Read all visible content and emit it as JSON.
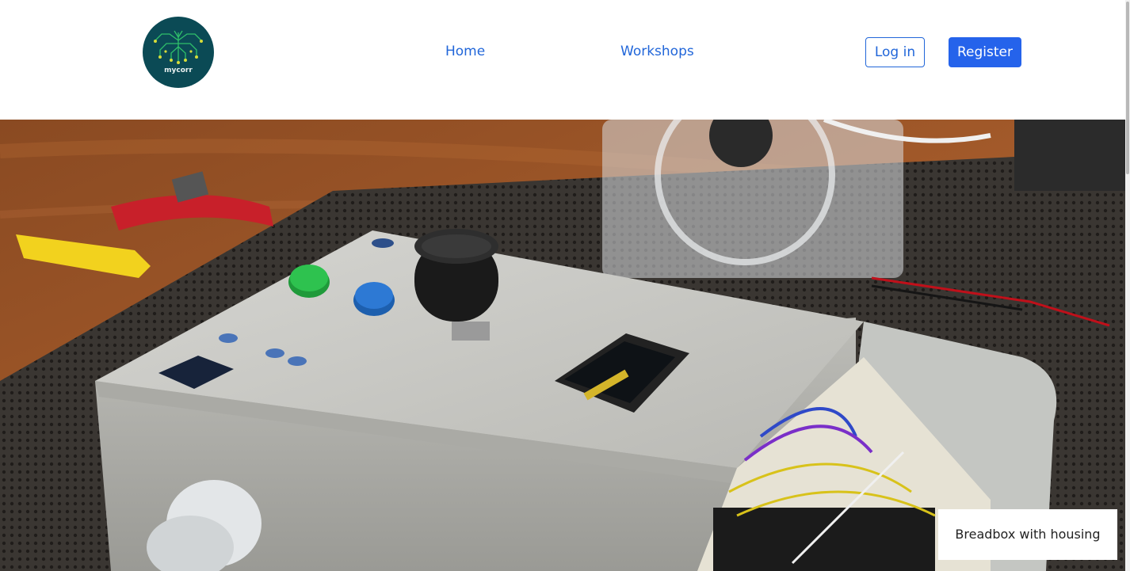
{
  "brand": {
    "logo_text": "mycorr",
    "logo_color": "#0b4a55",
    "logo_accent": "#c9d23a"
  },
  "nav": {
    "items": [
      {
        "label": "Home"
      },
      {
        "label": "Workshops"
      }
    ]
  },
  "auth": {
    "login_label": "Log in",
    "register_label": "Register"
  },
  "hero": {
    "caption": "Breadbox with housing"
  },
  "colors": {
    "link": "#2166d9",
    "primary": "#2563eb"
  }
}
